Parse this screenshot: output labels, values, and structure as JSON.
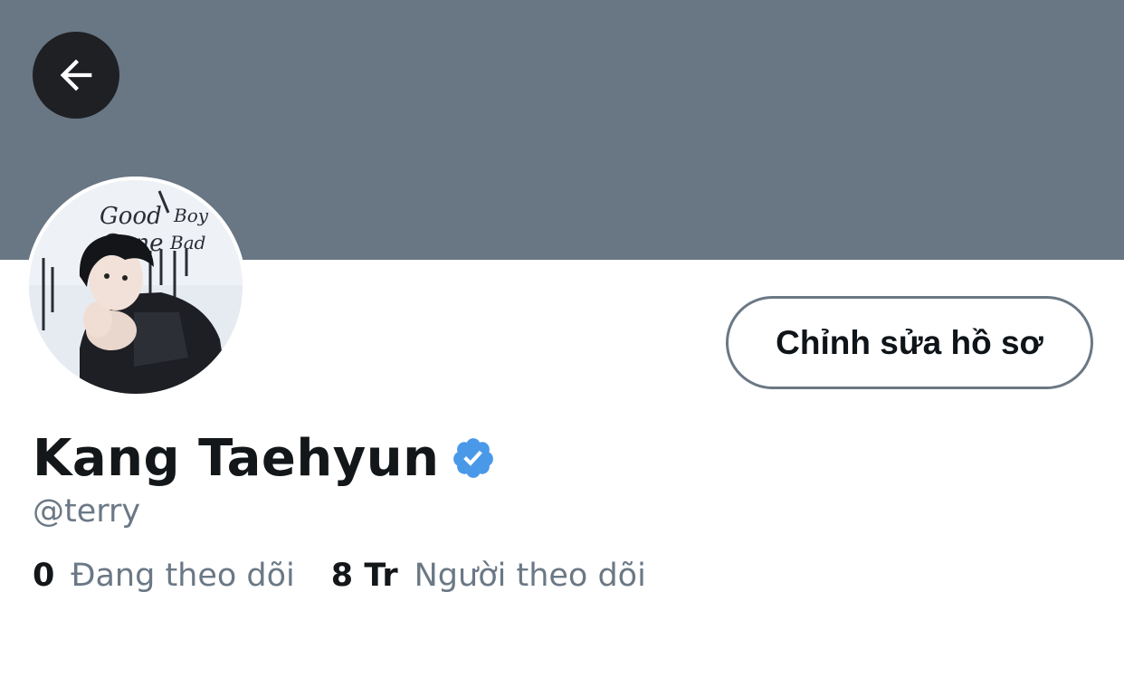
{
  "profile": {
    "display_name": "Kang Taehyun",
    "handle": "@terry",
    "verified": true,
    "avatar_graffiti": [
      "Good",
      "Boy",
      "Gone",
      "Bad"
    ]
  },
  "actions": {
    "edit_profile_label": "Chỉnh sửa hồ sơ"
  },
  "stats": {
    "following_count": "0",
    "following_label": "Đang theo dõi",
    "followers_count": "8 Tr",
    "followers_label": "Người theo dõi"
  },
  "icons": {
    "back": "arrow-left-icon",
    "verified": "verified-badge-icon"
  },
  "colors": {
    "banner": "#697684",
    "verified_blue": "#4a99e9",
    "secondary_text": "#6b7885",
    "primary_text": "#14171a"
  }
}
